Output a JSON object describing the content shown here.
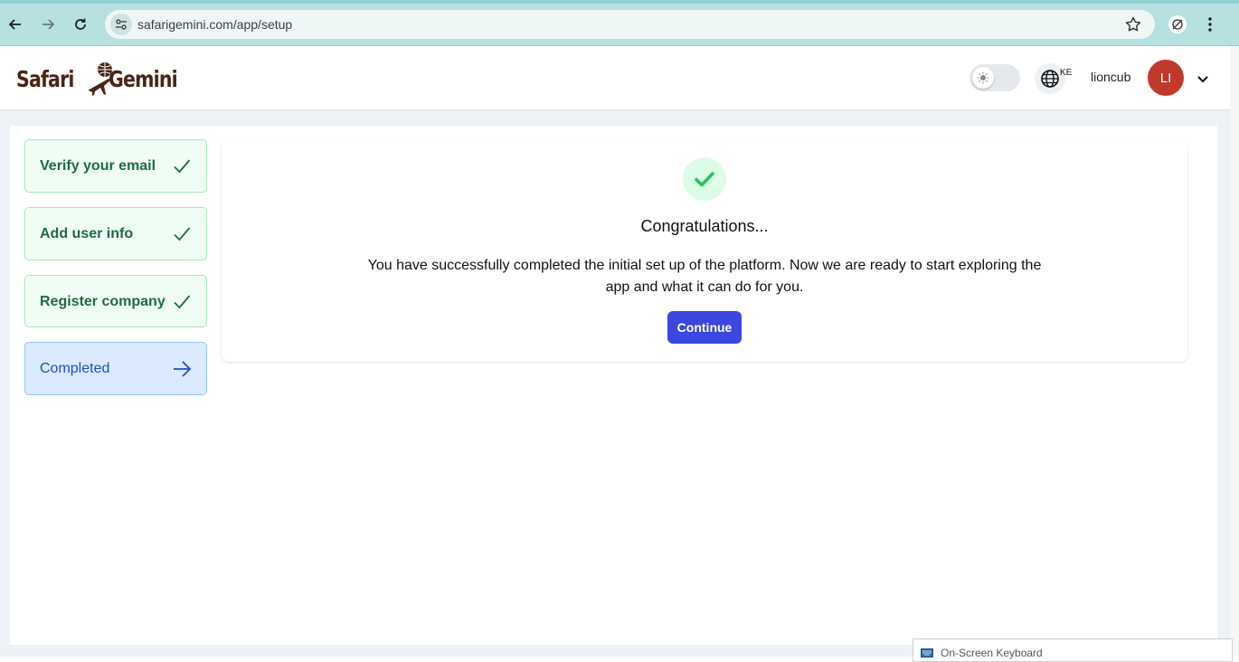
{
  "browser": {
    "url": "safarigemini.com/app/setup"
  },
  "header": {
    "logo_word_1": "Safari",
    "logo_word_2": "Gemini",
    "language_code": "KE",
    "username": "lioncub",
    "avatar_initials": "LI",
    "avatar_color": "#c0392b"
  },
  "steps": [
    {
      "label": "Verify your email",
      "status": "done"
    },
    {
      "label": "Add user info",
      "status": "done"
    },
    {
      "label": "Register company",
      "status": "done"
    },
    {
      "label": "Completed",
      "status": "current"
    }
  ],
  "main": {
    "title": "Congratulations...",
    "message": "You have successfully completed the initial set up of the platform. Now we are ready to start exploring the app and what it can do for you.",
    "continue_label": "Continue"
  },
  "taskbar": {
    "osk_title": "On-Screen Keyboard"
  },
  "colors": {
    "done_green": "#1e6b42",
    "current_blue": "#1d4ed8",
    "primary_button": "#3b47de",
    "success_check": "#22c55e"
  }
}
